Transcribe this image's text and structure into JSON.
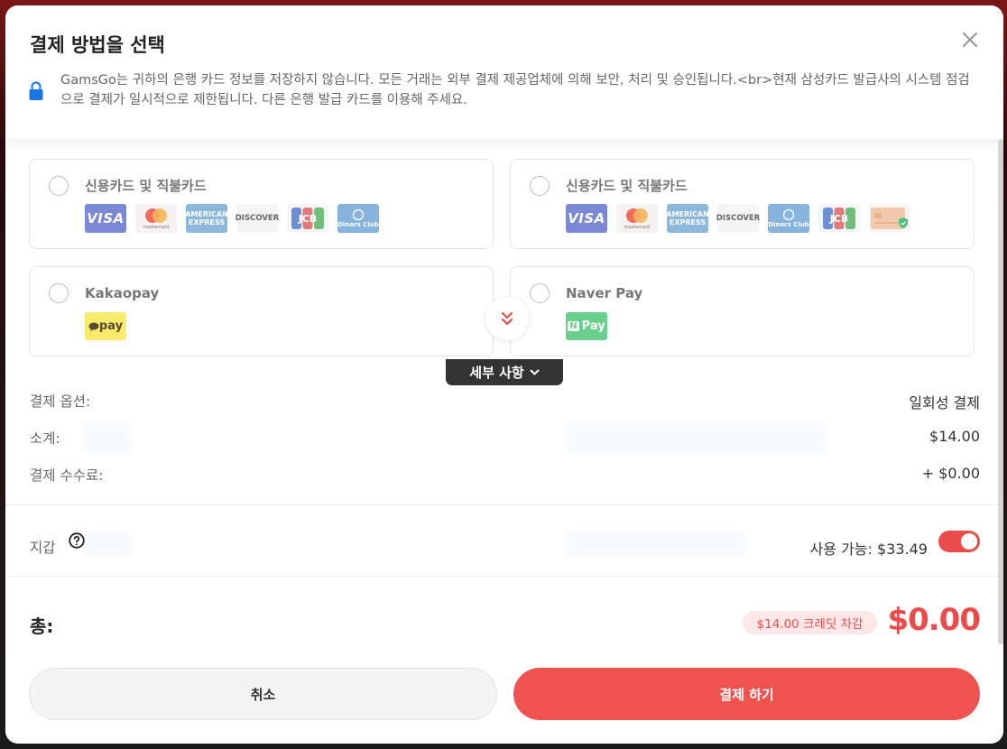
{
  "header": {
    "title": "결제 방법을 선택",
    "notice": "GamsGo는 귀하의 은행 카드 정보를 저장하지 않습니다. 모든 거래는 외부 결제 제공업체에 의해 보안, 처리 및 승인됩니다.<br>현재 삼성카드 발급사의 시스템 점검으로 결제가 일시적으로 제한됩니다. 다른 은행 발급 카드를 이용해 주세요."
  },
  "methods": [
    {
      "name": "신용카드 및 직불카드",
      "logos": [
        "VISA",
        "mastercard",
        "AMERICAN EXPRESS",
        "DISCOVER",
        "JCB",
        "Diners Club"
      ]
    },
    {
      "name": "신용카드 및 직불카드",
      "logos": [
        "VISA",
        "mastercard",
        "AMERICAN EXPRESS",
        "DISCOVER",
        "Diners Club",
        "JCB",
        "card"
      ]
    },
    {
      "name": "Kakaopay",
      "logo_text": "pay"
    },
    {
      "name": "Naver Pay",
      "logo_text": "Pay",
      "logo_mark": "N"
    }
  ],
  "details": {
    "toggle_label": "세부 사항",
    "payment_option_label": "결제 옵션:",
    "payment_option_value": "일회성 결제",
    "subtotal_label": "소계:",
    "subtotal_value": "$14.00",
    "fee_label": "결제 수수료:",
    "fee_value": "+ $0.00"
  },
  "wallet": {
    "label": "지갑",
    "available": "사용 가능: $33.49",
    "enabled": true
  },
  "total": {
    "label": "총:",
    "credit_badge": "$14.00 크레딧 차감",
    "amount": "$0.00"
  },
  "actions": {
    "cancel": "취소",
    "pay": "결제 하기"
  },
  "colors": {
    "accent": "#ef5350",
    "visa": "#7a88d6",
    "kakao": "#f8ea6b",
    "naver": "#68cf8d"
  }
}
